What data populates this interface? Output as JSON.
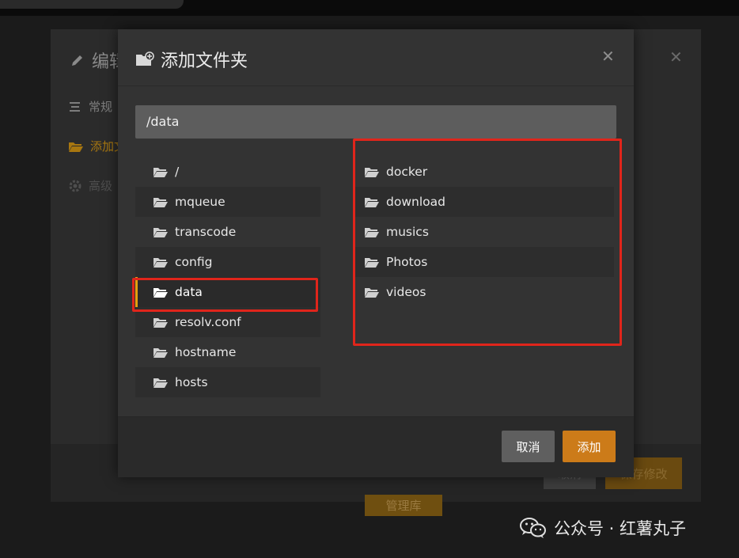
{
  "background_dialog": {
    "title": "编辑",
    "nav": [
      "常规",
      "添加文",
      "高级"
    ],
    "cancel_label": "取消",
    "save_label": "保存修改",
    "manage_label": "管理库"
  },
  "modal": {
    "title": "添加文件夹",
    "path": "/data",
    "left_items": [
      "/",
      "mqueue",
      "transcode",
      "config",
      "data",
      "resolv.conf",
      "hostname",
      "hosts"
    ],
    "selected": "data",
    "right_items": [
      "docker",
      "download",
      "musics",
      "Photos",
      "videos"
    ],
    "cancel_label": "取消",
    "add_label": "添加"
  },
  "watermark": "公众号 · 红薯丸子",
  "colors": {
    "accent": "#cc7b19",
    "selection_bar": "#e5a00d",
    "highlight_box": "#e0251b"
  }
}
